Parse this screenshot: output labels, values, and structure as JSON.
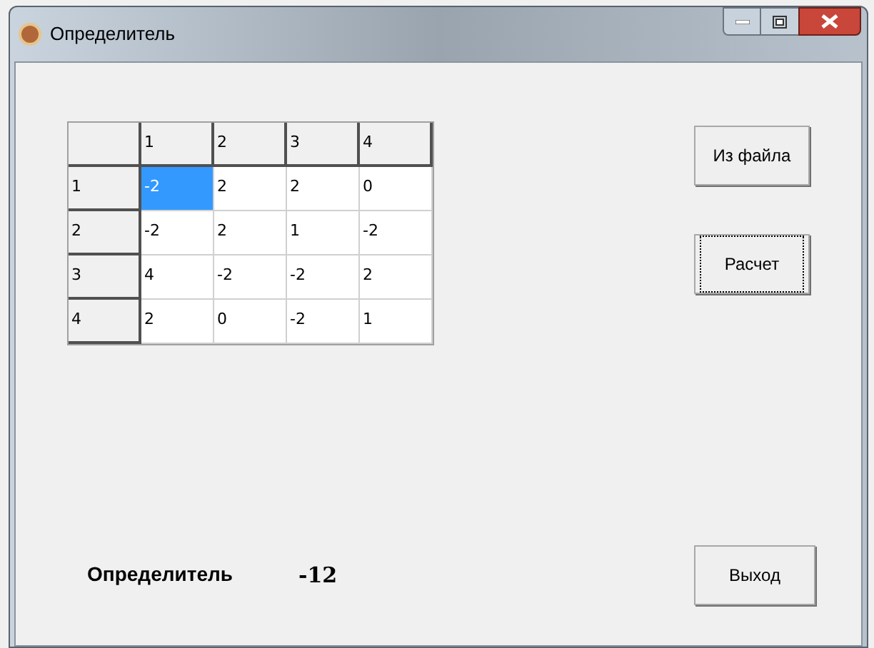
{
  "window": {
    "title": "Определитель"
  },
  "grid": {
    "columns": [
      "1",
      "2",
      "3",
      "4"
    ],
    "rows": [
      {
        "header": "1",
        "cells": [
          {
            "text": "-2",
            "selected": true
          },
          {
            "text": "2",
            "selected": false
          },
          {
            "text": "2",
            "selected": false
          },
          {
            "text": "0",
            "selected": false
          }
        ]
      },
      {
        "header": "2",
        "cells": [
          {
            "text": "-2",
            "selected": false
          },
          {
            "text": "2",
            "selected": false
          },
          {
            "text": "1",
            "selected": false
          },
          {
            "text": "-2",
            "selected": false
          }
        ]
      },
      {
        "header": "3",
        "cells": [
          {
            "text": "4",
            "selected": false
          },
          {
            "text": "-2",
            "selected": false
          },
          {
            "text": "-2",
            "selected": false
          },
          {
            "text": "2",
            "selected": false
          }
        ]
      },
      {
        "header": "4",
        "cells": [
          {
            "text": "2",
            "selected": false
          },
          {
            "text": "0",
            "selected": false
          },
          {
            "text": "-2",
            "selected": false
          },
          {
            "text": "1",
            "selected": false
          }
        ]
      }
    ]
  },
  "buttons": [
    {
      "label": "Из файла",
      "focused": false
    },
    {
      "label": "Расчет",
      "focused": true
    }
  ],
  "result": {
    "label": "Определитель",
    "value": "-12"
  },
  "exit_button": {
    "label": "Выход",
    "focused": false
  }
}
